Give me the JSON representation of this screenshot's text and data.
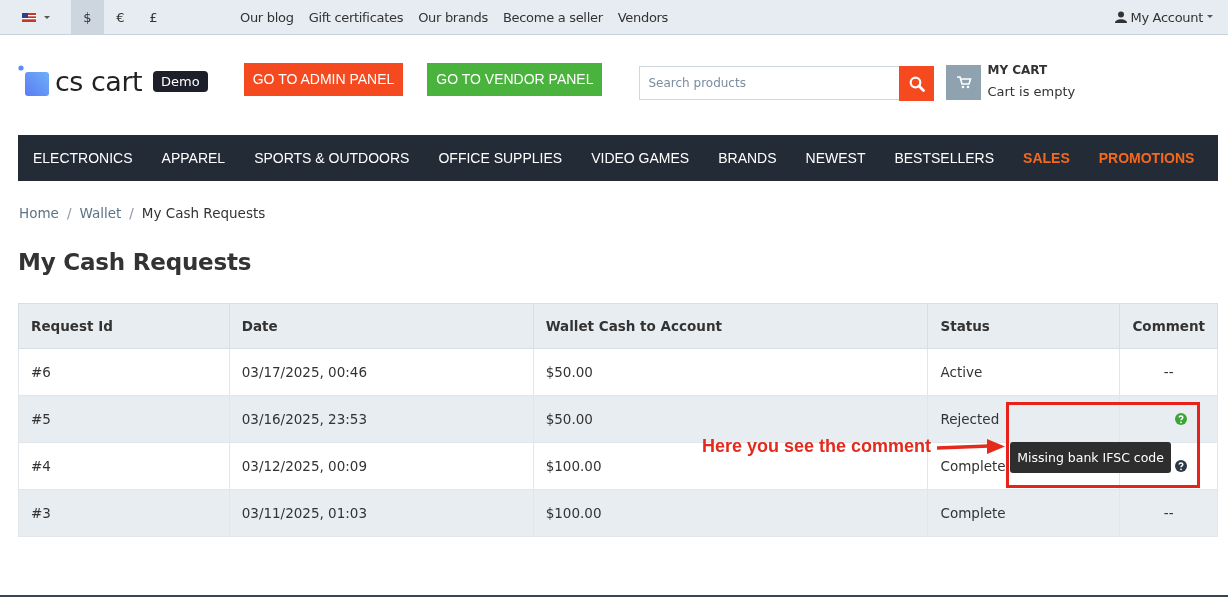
{
  "top_bar": {
    "currencies": [
      {
        "label": "$",
        "selected": true
      },
      {
        "label": "€",
        "selected": false
      },
      {
        "label": "£",
        "selected": false
      }
    ],
    "links": [
      "Our blog",
      "Gift certificates",
      "Our brands",
      "Become a seller",
      "Vendors"
    ],
    "account": "My Account"
  },
  "header": {
    "logo_text": "cs cart",
    "logo_badge": "Demo",
    "buttons": [
      {
        "label": "GO TO ADMIN PANEL",
        "kind": "admin"
      },
      {
        "label": "GO TO VENDOR PANEL",
        "kind": "vendor"
      }
    ],
    "search": {
      "placeholder": "Search products"
    },
    "cart": {
      "title": "MY CART",
      "status": "Cart is empty"
    }
  },
  "nav": [
    {
      "label": "ELECTRONICS",
      "highlight": false
    },
    {
      "label": "APPAREL",
      "highlight": false
    },
    {
      "label": "SPORTS & OUTDOORS",
      "highlight": false
    },
    {
      "label": "OFFICE SUPPLIES",
      "highlight": false
    },
    {
      "label": "VIDEO GAMES",
      "highlight": false
    },
    {
      "label": "BRANDS",
      "highlight": false
    },
    {
      "label": "NEWEST",
      "highlight": false
    },
    {
      "label": "BESTSELLERS",
      "highlight": false
    },
    {
      "label": "SALES",
      "highlight": true
    },
    {
      "label": "PROMOTIONS",
      "highlight": true
    }
  ],
  "breadcrumb": [
    {
      "kind": "link",
      "label": "Home"
    },
    {
      "kind": "separator",
      "label": "/"
    },
    {
      "kind": "link",
      "label": "Wallet"
    },
    {
      "kind": "separator",
      "label": "/"
    },
    {
      "kind": "current",
      "label": "My Cash Requests"
    }
  ],
  "title": "My Cash Requests",
  "table": {
    "columns": [
      "Request Id",
      "Date",
      "Wallet Cash to Account",
      "Status",
      "Comment"
    ],
    "rows": [
      {
        "id": "#6",
        "date": "03/17/2025, 00:46",
        "amount": "$50.00",
        "status": "Active",
        "comment": {
          "kind": "text",
          "text": "--"
        }
      },
      {
        "id": "#5",
        "date": "03/16/2025, 23:53",
        "amount": "$50.00",
        "status": "Rejected",
        "comment": {
          "kind": "icon",
          "active": true
        }
      },
      {
        "id": "#4",
        "date": "03/12/2025, 00:09",
        "amount": "$100.00",
        "status": "Complete",
        "comment": {
          "kind": "icon",
          "active": false
        }
      },
      {
        "id": "#3",
        "date": "03/11/2025, 01:03",
        "amount": "$100.00",
        "status": "Complete",
        "comment": {
          "kind": "text",
          "text": "--"
        }
      }
    ]
  },
  "tooltip": {
    "text": "Missing bank IFSC code"
  },
  "annotation": {
    "text": "Here you see the comment"
  }
}
